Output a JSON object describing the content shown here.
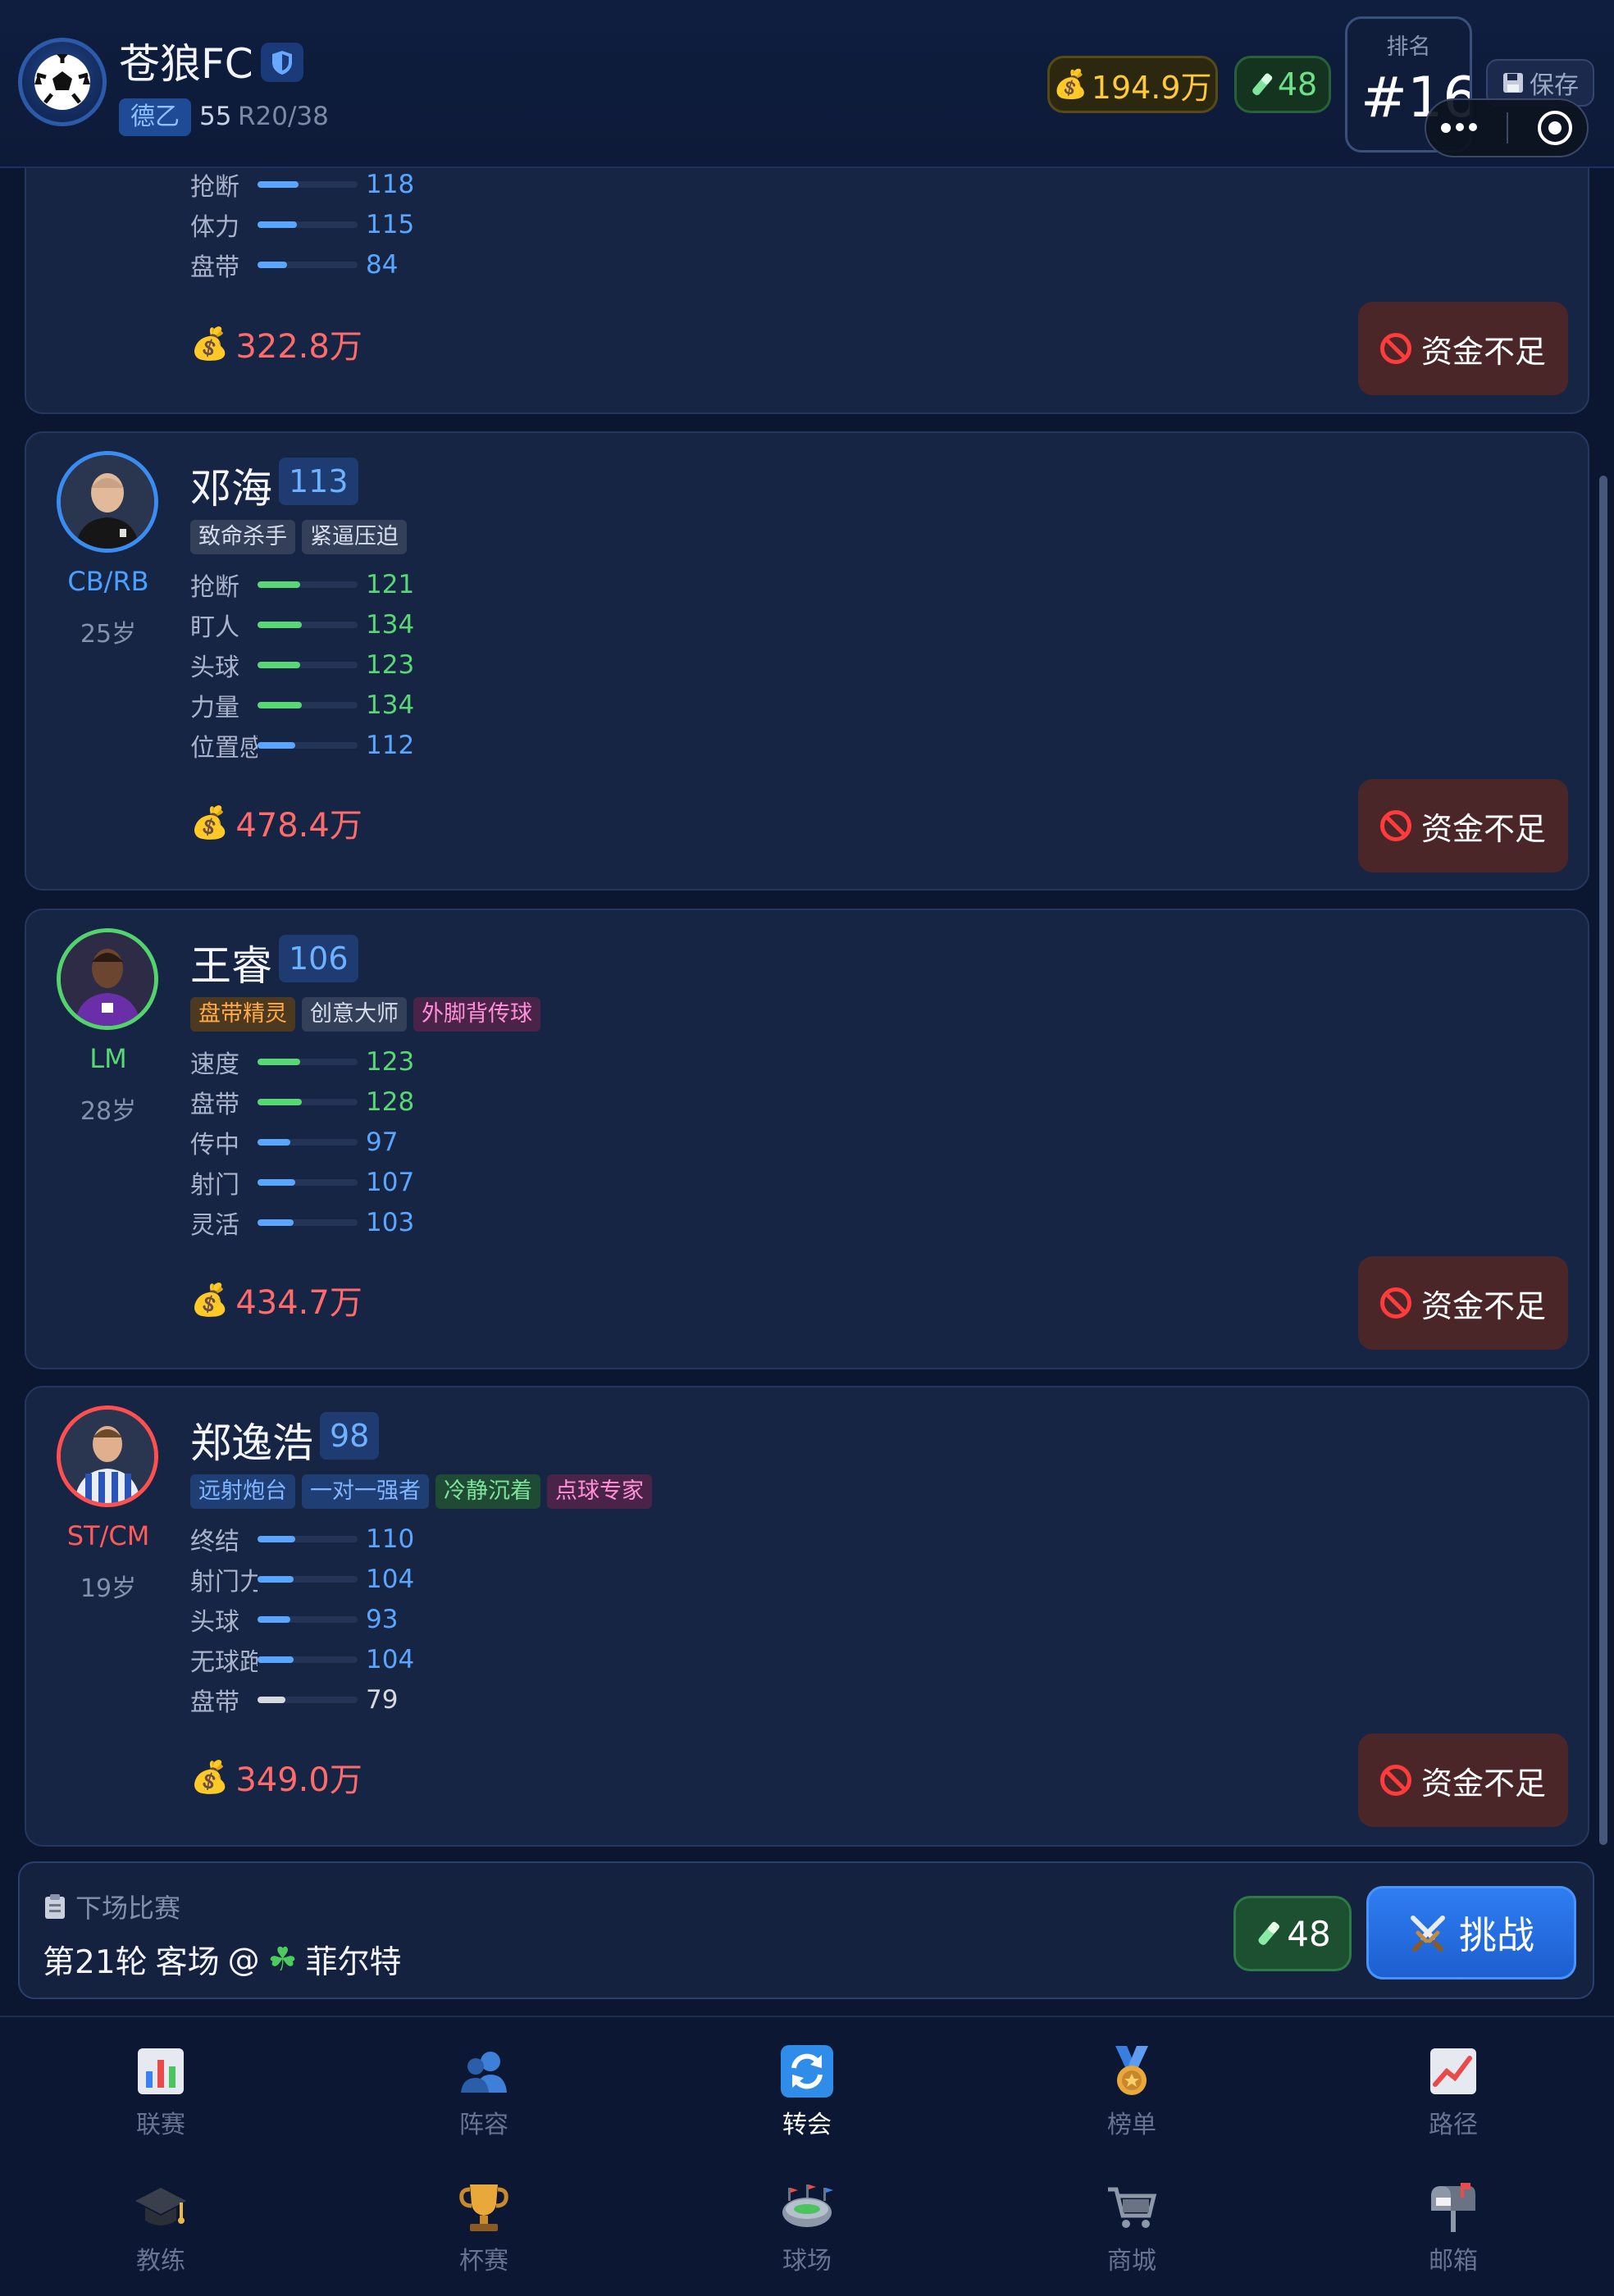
{
  "header": {
    "club_name": "苍狼FC",
    "league": "德乙",
    "rating": "55",
    "round": "R20/38",
    "money": "194.9万",
    "energy": "48",
    "rank_label": "排名",
    "rank_value": "#16",
    "save_label": "保存"
  },
  "players": [
    {
      "stats": [
        {
          "name": "抢断",
          "value": "118",
          "color": "#5aa6ff"
        },
        {
          "name": "体力",
          "value": "115",
          "color": "#5aa6ff"
        },
        {
          "name": "盘带",
          "value": "84",
          "color": "#5aa6ff"
        }
      ],
      "price": "322.8万",
      "button": "资金不足"
    },
    {
      "name": "邓海",
      "ovr": "113",
      "position": "CB/RB",
      "position_color": "#4aa0ff",
      "age": "25岁",
      "tags": [
        {
          "label": "致命杀手",
          "style": "grey"
        },
        {
          "label": "紧逼压迫",
          "style": "grey"
        }
      ],
      "stats": [
        {
          "name": "抢断",
          "value": "121",
          "color": "#58d874"
        },
        {
          "name": "盯人",
          "value": "134",
          "color": "#58d874"
        },
        {
          "name": "头球",
          "value": "123",
          "color": "#58d874"
        },
        {
          "name": "力量",
          "value": "134",
          "color": "#58d874"
        },
        {
          "name": "位置感",
          "value": "112",
          "color": "#5aa6ff"
        }
      ],
      "price": "478.4万",
      "button": "资金不足"
    },
    {
      "name": "王睿",
      "ovr": "106",
      "position": "LM",
      "position_color": "#58d874",
      "age": "28岁",
      "tags": [
        {
          "label": "盘带精灵",
          "style": "orange"
        },
        {
          "label": "创意大师",
          "style": "grey"
        },
        {
          "label": "外脚背传球",
          "style": "pink"
        }
      ],
      "stats": [
        {
          "name": "速度",
          "value": "123",
          "color": "#58d874"
        },
        {
          "name": "盘带",
          "value": "128",
          "color": "#58d874"
        },
        {
          "name": "传中",
          "value": "97",
          "color": "#5aa6ff"
        },
        {
          "name": "射门",
          "value": "107",
          "color": "#5aa6ff"
        },
        {
          "name": "灵活",
          "value": "103",
          "color": "#5aa6ff"
        }
      ],
      "price": "434.7万",
      "button": "资金不足"
    },
    {
      "name": "郑逸浩",
      "ovr": "98",
      "position": "ST/CM",
      "position_color": "#ff5a5a",
      "age": "19岁",
      "tags": [
        {
          "label": "远射炮台",
          "style": "blue"
        },
        {
          "label": "一对一强者",
          "style": "blue"
        },
        {
          "label": "冷静沉着",
          "style": "green"
        },
        {
          "label": "点球专家",
          "style": "pink"
        }
      ],
      "stats": [
        {
          "name": "终结",
          "value": "110",
          "color": "#5aa6ff"
        },
        {
          "name": "射门力量",
          "value": "104",
          "color": "#5aa6ff"
        },
        {
          "name": "头球",
          "value": "93",
          "color": "#5aa6ff"
        },
        {
          "name": "无球跑动",
          "value": "104",
          "color": "#5aa6ff"
        },
        {
          "name": "盘带",
          "value": "79",
          "color": "#d6d9e0"
        }
      ],
      "price": "349.0万",
      "button": "资金不足"
    }
  ],
  "next_match": {
    "label": "下场比赛",
    "round": "第21轮",
    "venue": "客场",
    "at": "@",
    "opponent": "菲尔特",
    "energy": "48",
    "challenge": "挑战"
  },
  "nav": [
    {
      "label": "联赛",
      "icon": "chart-icon"
    },
    {
      "label": "阵容",
      "icon": "users-icon"
    },
    {
      "label": "转会",
      "icon": "transfer-icon",
      "active": true
    },
    {
      "label": "榜单",
      "icon": "medal-icon"
    },
    {
      "label": "路径",
      "icon": "trend-icon"
    },
    {
      "label": "教练",
      "icon": "graduation-cap-icon"
    },
    {
      "label": "杯赛",
      "icon": "trophy-icon"
    },
    {
      "label": "球场",
      "icon": "stadium-icon"
    },
    {
      "label": "商城",
      "icon": "cart-icon"
    },
    {
      "label": "邮箱",
      "icon": "mailbox-icon"
    }
  ],
  "colors": {
    "accent": "#2f7df2",
    "danger": "#ff6b6b",
    "gold": "#ffc93a",
    "green": "#58d874"
  }
}
